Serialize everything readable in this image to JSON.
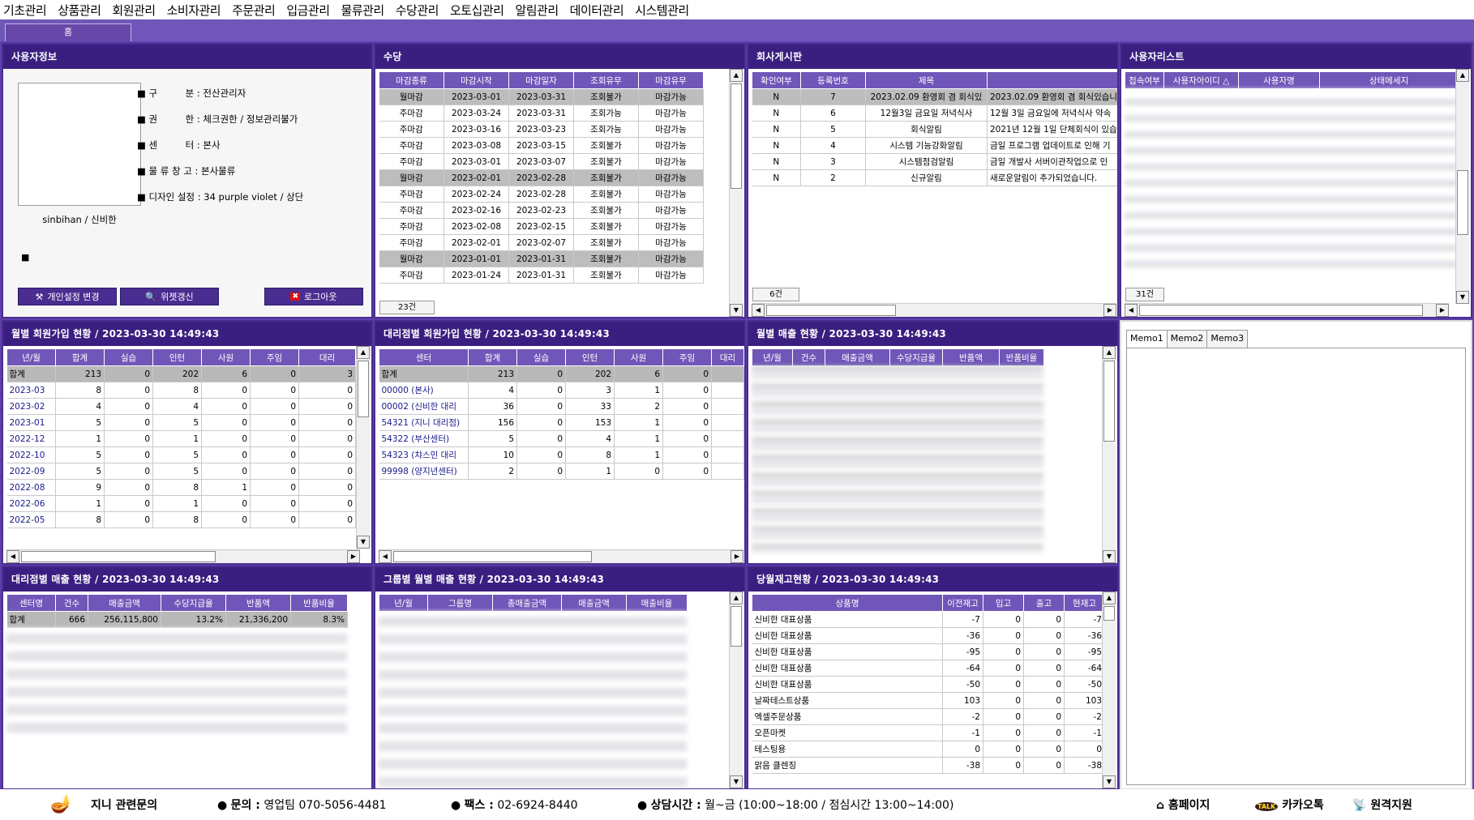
{
  "menu": [
    "기초관리",
    "상품관리",
    "회원관리",
    "소비자관리",
    "주문관리",
    "입금관리",
    "물류관리",
    "수당관리",
    "오토십관리",
    "알림관리",
    "데이터관리",
    "시스템관리"
  ],
  "tab_home": "홈",
  "user_info": {
    "title": "사용자정보",
    "rows": [
      {
        "label": "■ 구　　　분 :",
        "value": "전산관리자"
      },
      {
        "label": "■ 권　　　한 :",
        "value": "체크권한 / 정보관리불가"
      },
      {
        "label": "■ 센　　　터 :",
        "value": "본사"
      },
      {
        "label": "■ 물 류 창 고 :",
        "value": "본사물류"
      },
      {
        "label": "■ 디자인 설정 :",
        "value": "34  purple violet / 상단"
      }
    ],
    "username": "sinbihan / 신비한",
    "bullet": "■",
    "btn_settings": "개인설정 변경",
    "btn_widget": "위젯갱신",
    "btn_logout": "로그아웃"
  },
  "sudang": {
    "title": "수당",
    "headers": [
      "마감종류",
      "마감시작",
      "마감일자",
      "조회유무",
      "마감유무"
    ],
    "rows": [
      [
        "월마감",
        "2023-03-01",
        "2023-03-31",
        "조회불가",
        "마감가능"
      ],
      [
        "주마감",
        "2023-03-24",
        "2023-03-31",
        "조회가능",
        "마감가능"
      ],
      [
        "주마감",
        "2023-03-16",
        "2023-03-23",
        "조회가능",
        "마감가능"
      ],
      [
        "주마감",
        "2023-03-08",
        "2023-03-15",
        "조회불가",
        "마감가능"
      ],
      [
        "주마감",
        "2023-03-01",
        "2023-03-07",
        "조회불가",
        "마감가능"
      ],
      [
        "월마감",
        "2023-02-01",
        "2023-02-28",
        "조회불가",
        "마감가능"
      ],
      [
        "주마감",
        "2023-02-24",
        "2023-02-28",
        "조회불가",
        "마감가능"
      ],
      [
        "주마감",
        "2023-02-16",
        "2023-02-23",
        "조회불가",
        "마감가능"
      ],
      [
        "주마감",
        "2023-02-08",
        "2023-02-15",
        "조회불가",
        "마감가능"
      ],
      [
        "주마감",
        "2023-02-01",
        "2023-02-07",
        "조회불가",
        "마감가능"
      ],
      [
        "월마감",
        "2023-01-01",
        "2023-01-31",
        "조회불가",
        "마감가능"
      ],
      [
        "주마감",
        "2023-01-24",
        "2023-01-31",
        "조회불가",
        "마감가능"
      ]
    ],
    "count": "23건"
  },
  "board": {
    "title": "회사게시판",
    "headers": [
      "확인여부",
      "등록번호",
      "제목",
      ""
    ],
    "rows": [
      [
        "N",
        "7",
        "2023.02.09 환영회 겸 회식있",
        "2023.02.09 환영회 겸 회식있습니"
      ],
      [
        "N",
        "6",
        "12월3일 금요일 저녁식사",
        "12월 3일 금요일에 저녁식사 약속"
      ],
      [
        "N",
        "5",
        "회식알림",
        "2021년 12월 1일 단체회식이 있습"
      ],
      [
        "N",
        "4",
        "시스템 기능강화알림",
        "금일 프로그램 업데이트로 인해 기"
      ],
      [
        "N",
        "3",
        "시스템점검알림",
        "금일 개발사 서버이관작업으로 인"
      ],
      [
        "N",
        "2",
        "신규알림",
        "새로운알림이 추가되었습니다."
      ]
    ],
    "count": "6건"
  },
  "users": {
    "title": "사용자리스트",
    "headers": [
      "접속여부",
      "사용자아이디  △",
      "사용자명",
      "상태메세지"
    ],
    "count": "31건"
  },
  "monthly_members": {
    "title": "월별 회원가입 현황 / 2023-03-30 14:49:43",
    "headers": [
      "년/월",
      "합계",
      "실습",
      "인턴",
      "사원",
      "주임",
      "대리"
    ],
    "rows": [
      [
        "합계",
        "213",
        "0",
        "202",
        "6",
        "0",
        "3"
      ],
      [
        "2023-03",
        "8",
        "0",
        "8",
        "0",
        "0",
        "0"
      ],
      [
        "2023-02",
        "4",
        "0",
        "4",
        "0",
        "0",
        "0"
      ],
      [
        "2023-01",
        "5",
        "0",
        "5",
        "0",
        "0",
        "0"
      ],
      [
        "2022-12",
        "1",
        "0",
        "1",
        "0",
        "0",
        "0"
      ],
      [
        "2022-10",
        "5",
        "0",
        "5",
        "0",
        "0",
        "0"
      ],
      [
        "2022-09",
        "5",
        "0",
        "5",
        "0",
        "0",
        "0"
      ],
      [
        "2022-08",
        "9",
        "0",
        "8",
        "1",
        "0",
        "0"
      ],
      [
        "2022-06",
        "1",
        "0",
        "1",
        "0",
        "0",
        "0"
      ],
      [
        "2022-05",
        "8",
        "0",
        "8",
        "0",
        "0",
        "0"
      ]
    ]
  },
  "agency_members": {
    "title": "대리점별 회원가입 현황 / 2023-03-30 14:49:43",
    "headers": [
      "센터",
      "합계",
      "실습",
      "인턴",
      "사원",
      "주임",
      "대리"
    ],
    "rows": [
      [
        "합계",
        "213",
        "0",
        "202",
        "6",
        "0",
        ""
      ],
      [
        "00000 (본사)",
        "4",
        "0",
        "3",
        "1",
        "0",
        ""
      ],
      [
        "00002 (신비한 대리",
        "36",
        "0",
        "33",
        "2",
        "0",
        ""
      ],
      [
        "54321 (지니 대리점)",
        "156",
        "0",
        "153",
        "1",
        "0",
        ""
      ],
      [
        "54322 (부산센터)",
        "5",
        "0",
        "4",
        "1",
        "0",
        ""
      ],
      [
        "54323 (챠스민 대리",
        "10",
        "0",
        "8",
        "1",
        "0",
        ""
      ],
      [
        "99998 (양지년센터)",
        "2",
        "0",
        "1",
        "0",
        "0",
        ""
      ]
    ]
  },
  "monthly_sales": {
    "title": "월별 매출 현황 / 2023-03-30 14:49:43",
    "headers": [
      "년/월",
      "건수",
      "매출금액",
      "수당지급율",
      "반품액",
      "반품비율"
    ]
  },
  "memo": {
    "tabs": [
      "Memo1",
      "Memo2",
      "Memo3"
    ]
  },
  "agency_sales": {
    "title": "대리점별 매출 현황 / 2023-03-30 14:49:43",
    "headers": [
      "센터명",
      "건수",
      "매출금액",
      "수당지급율",
      "반품액",
      "반품비율"
    ],
    "sum": [
      "합계",
      "666",
      "256,115,800",
      "13.2%",
      "21,336,200",
      "8.3%"
    ]
  },
  "group_sales": {
    "title": "그룹별 월별 매출 현황 / 2023-03-30 14:49:43",
    "headers": [
      "년/월",
      "그룹명",
      "총매출금액",
      "매출금액",
      "매출비율"
    ]
  },
  "stock": {
    "title": "당월재고현황 / 2023-03-30 14:49:43",
    "headers": [
      "상품명",
      "이전재고",
      "입고",
      "출고",
      "현재고"
    ],
    "rows": [
      [
        "신비한 대표상품",
        "-7",
        "0",
        "0",
        "-7"
      ],
      [
        "신비한 대표상품",
        "-36",
        "0",
        "0",
        "-36"
      ],
      [
        "신비한 대표상품",
        "-95",
        "0",
        "0",
        "-95"
      ],
      [
        "신비한 대표상품",
        "-64",
        "0",
        "0",
        "-64"
      ],
      [
        "신비한 대표상품",
        "-50",
        "0",
        "0",
        "-50"
      ],
      [
        "날짜테스트상품",
        "103",
        "0",
        "0",
        "103"
      ],
      [
        "엑셀주문상품",
        "-2",
        "0",
        "0",
        "-2"
      ],
      [
        "오픈마켓",
        "-1",
        "0",
        "0",
        "-1"
      ],
      [
        "테스팅용",
        "0",
        "0",
        "0",
        "0"
      ],
      [
        "맑음 클렌징",
        "-38",
        "0",
        "0",
        "-38"
      ]
    ]
  },
  "footer": {
    "brand": "지니 관련문의",
    "contact_label": "문의 :",
    "contact_value": "영업팀 070-5056-4481",
    "fax_label": "팩스 :",
    "fax_value": "02-6924-8440",
    "hours_label": "상담시간 :",
    "hours_value": "월~금 (10:00~18:00 / 점심시간 13:00~14:00)",
    "homepage": "홈페이지",
    "kakao": "카카오톡",
    "remote": "원격지원"
  }
}
